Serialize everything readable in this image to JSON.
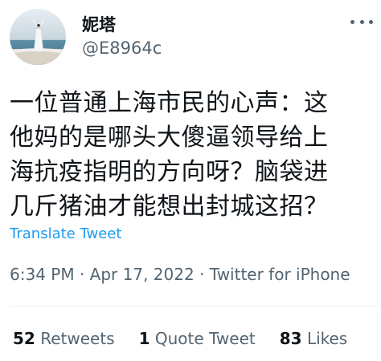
{
  "author": {
    "display_name": "妮塔",
    "handle": "@E8964c"
  },
  "tweet": {
    "lines": [
      "一位普通上海市民的心声：这",
      "他妈的是哪头大傻逼领导给上",
      "海抗疫指明的方向呀？脑袋进",
      "几斤猪油才能想出封城这招？"
    ],
    "translate_label": "Translate Tweet",
    "meta": {
      "time": "6:34 PM",
      "sep1": " · ",
      "date": "Apr 17, 2022",
      "sep2": " · ",
      "source": "Twitter for iPhone"
    }
  },
  "stats": {
    "retweets": {
      "count": "52",
      "label": "Retweets"
    },
    "quote_tweets": {
      "count": "1",
      "label": "Quote Tweet"
    },
    "likes": {
      "count": "83",
      "label": "Likes"
    }
  },
  "colors": {
    "text_primary": "#0f1419",
    "text_secondary": "#536471",
    "link": "#1d9bf0",
    "divider": "#eff3f4"
  },
  "icons": {
    "more": "more-icon"
  }
}
